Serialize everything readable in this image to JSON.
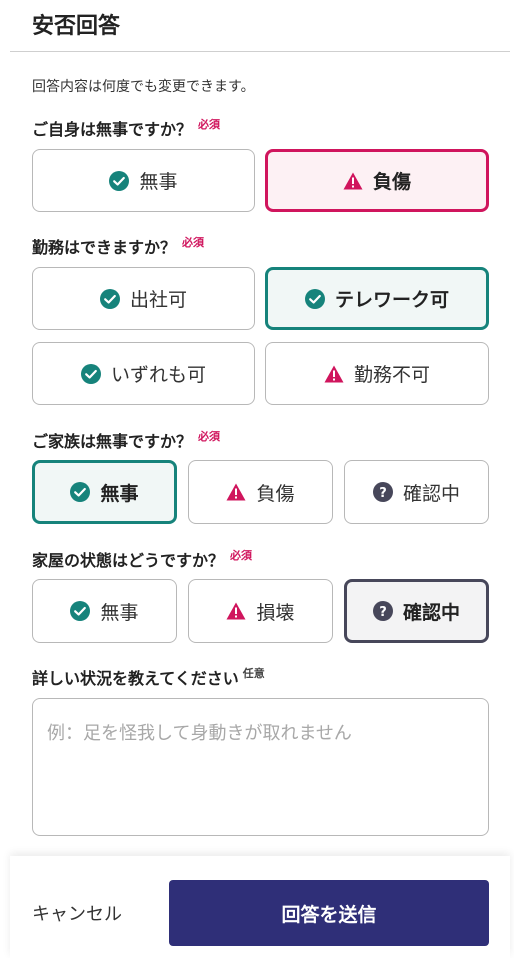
{
  "header": {
    "title": "安否回答"
  },
  "note": "回答内容は何度でも変更できます。",
  "required_tag": "必須",
  "optional_tag": "任意",
  "questions": {
    "self": {
      "label": "ご自身は無事ですか？",
      "options": [
        {
          "label": "無事",
          "icon": "check-circle-icon",
          "selected": false
        },
        {
          "label": "負傷",
          "icon": "warning-icon",
          "selected": true
        }
      ]
    },
    "work": {
      "label": "勤務はできますか？",
      "options": [
        {
          "label": "出社可",
          "icon": "check-circle-icon",
          "selected": false
        },
        {
          "label": "テレワーク可",
          "icon": "check-circle-icon",
          "selected": true
        },
        {
          "label": "いずれも可",
          "icon": "check-circle-icon",
          "selected": false
        },
        {
          "label": "勤務不可",
          "icon": "warning-icon",
          "selected": false
        }
      ]
    },
    "family": {
      "label": "ご家族は無事ですか？",
      "options": [
        {
          "label": "無事",
          "icon": "check-circle-icon",
          "selected": true
        },
        {
          "label": "負傷",
          "icon": "warning-icon",
          "selected": false
        },
        {
          "label": "確認中",
          "icon": "question-circle-icon",
          "selected": false
        }
      ]
    },
    "house": {
      "label": "家屋の状態はどうですか？",
      "options": [
        {
          "label": "無事",
          "icon": "check-circle-icon",
          "selected": false
        },
        {
          "label": "損壊",
          "icon": "warning-icon",
          "selected": false
        },
        {
          "label": "確認中",
          "icon": "question-circle-icon",
          "selected": true
        }
      ]
    },
    "details": {
      "label": "詳しい状況を教えてください",
      "placeholder": "例：足を怪我して身動きが取れません"
    }
  },
  "footer": {
    "cancel_label": "キャンセル",
    "submit_label": "回答を送信"
  },
  "colors": {
    "teal": "#16837b",
    "red": "#d0155d",
    "navy": "#47475a",
    "primary": "#2f2f78"
  }
}
